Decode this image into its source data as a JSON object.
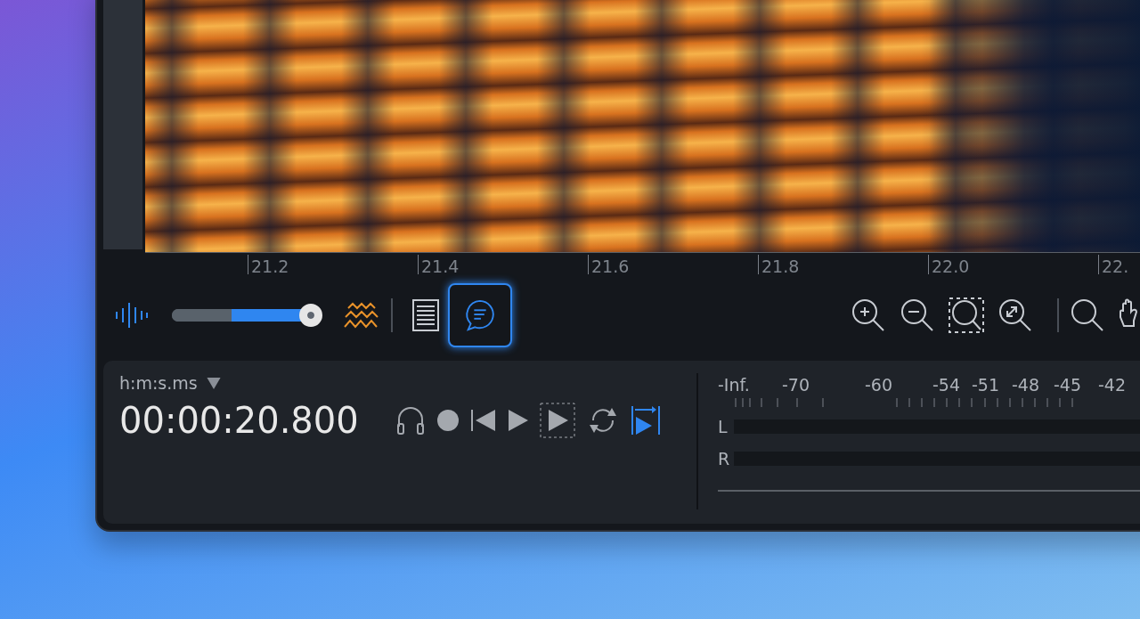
{
  "ruler": {
    "labels": [
      "21.2",
      "21.4",
      "21.6",
      "21.8",
      "22.0",
      "22."
    ]
  },
  "view_slider": {
    "level": 0.93
  },
  "view_tools": [
    {
      "kind": "spectrogram",
      "selected": false
    },
    {
      "kind": "list",
      "selected": false
    },
    {
      "kind": "comment",
      "selected": true
    }
  ],
  "time_format": {
    "label": "h:m:s.ms"
  },
  "time_display": "00:00:20.800",
  "transport": [
    {
      "kind": "monitor",
      "on": false
    },
    {
      "kind": "record",
      "on": false
    },
    {
      "kind": "to-start",
      "on": false
    },
    {
      "kind": "play",
      "on": false
    },
    {
      "kind": "play-selection",
      "on": false
    },
    {
      "kind": "loop",
      "on": false
    },
    {
      "kind": "play-to-end",
      "on": true
    }
  ],
  "meter": {
    "scale": [
      "-Inf.",
      "-70",
      "-60",
      "-54",
      "-51",
      "-48",
      "-45",
      "-42"
    ],
    "channels": [
      {
        "label": "L"
      },
      {
        "label": "R"
      }
    ]
  }
}
